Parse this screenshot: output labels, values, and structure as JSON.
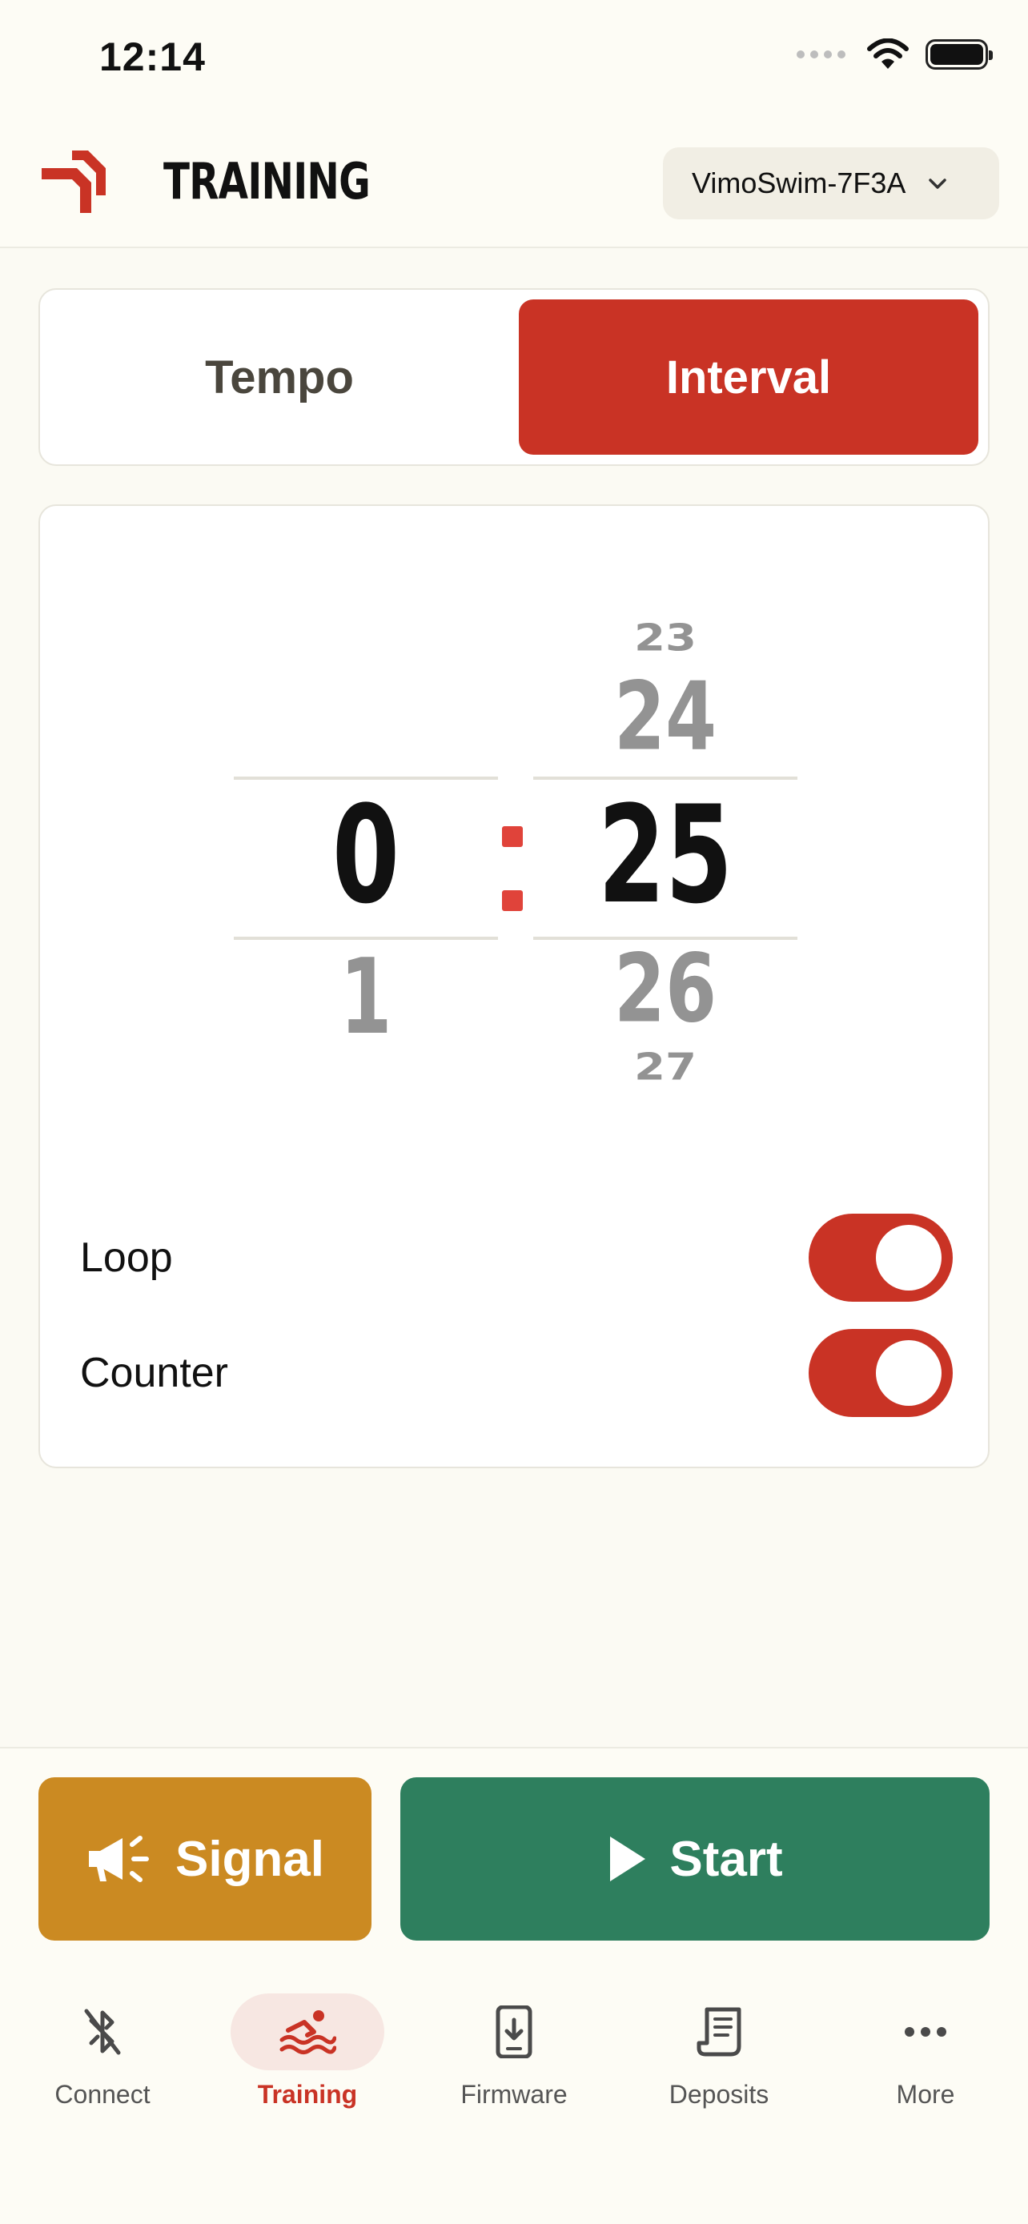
{
  "status_bar": {
    "time": "12:14"
  },
  "header": {
    "title": "TRAINING",
    "device": "VimoSwim-7F3A"
  },
  "mode_tabs": [
    {
      "label": "Tempo",
      "selected": false
    },
    {
      "label": "Interval",
      "selected": true
    }
  ],
  "picker": {
    "minutes": {
      "selected": "0",
      "below": [
        "1"
      ]
    },
    "separator": ":",
    "seconds": {
      "above": [
        "23",
        "24"
      ],
      "selected": "25",
      "below": [
        "26",
        "27"
      ]
    }
  },
  "toggles": [
    {
      "label": "Loop",
      "on": true
    },
    {
      "label": "Counter",
      "on": true
    }
  ],
  "actions": {
    "signal": "Signal",
    "start": "Start"
  },
  "nav": [
    {
      "label": "Connect",
      "icon": "bluetooth-off-icon",
      "active": false
    },
    {
      "label": "Training",
      "icon": "swimmer-icon",
      "active": true
    },
    {
      "label": "Firmware",
      "icon": "phone-download-icon",
      "active": false
    },
    {
      "label": "Deposits",
      "icon": "receipt-icon",
      "active": false
    },
    {
      "label": "More",
      "icon": "more-dots-icon",
      "active": false
    }
  ],
  "colors": {
    "accent": "#c93325",
    "signal": "#cb8a22",
    "start": "#2e7f5e",
    "colon": "#e0433a",
    "background": "#fbfaf3"
  }
}
